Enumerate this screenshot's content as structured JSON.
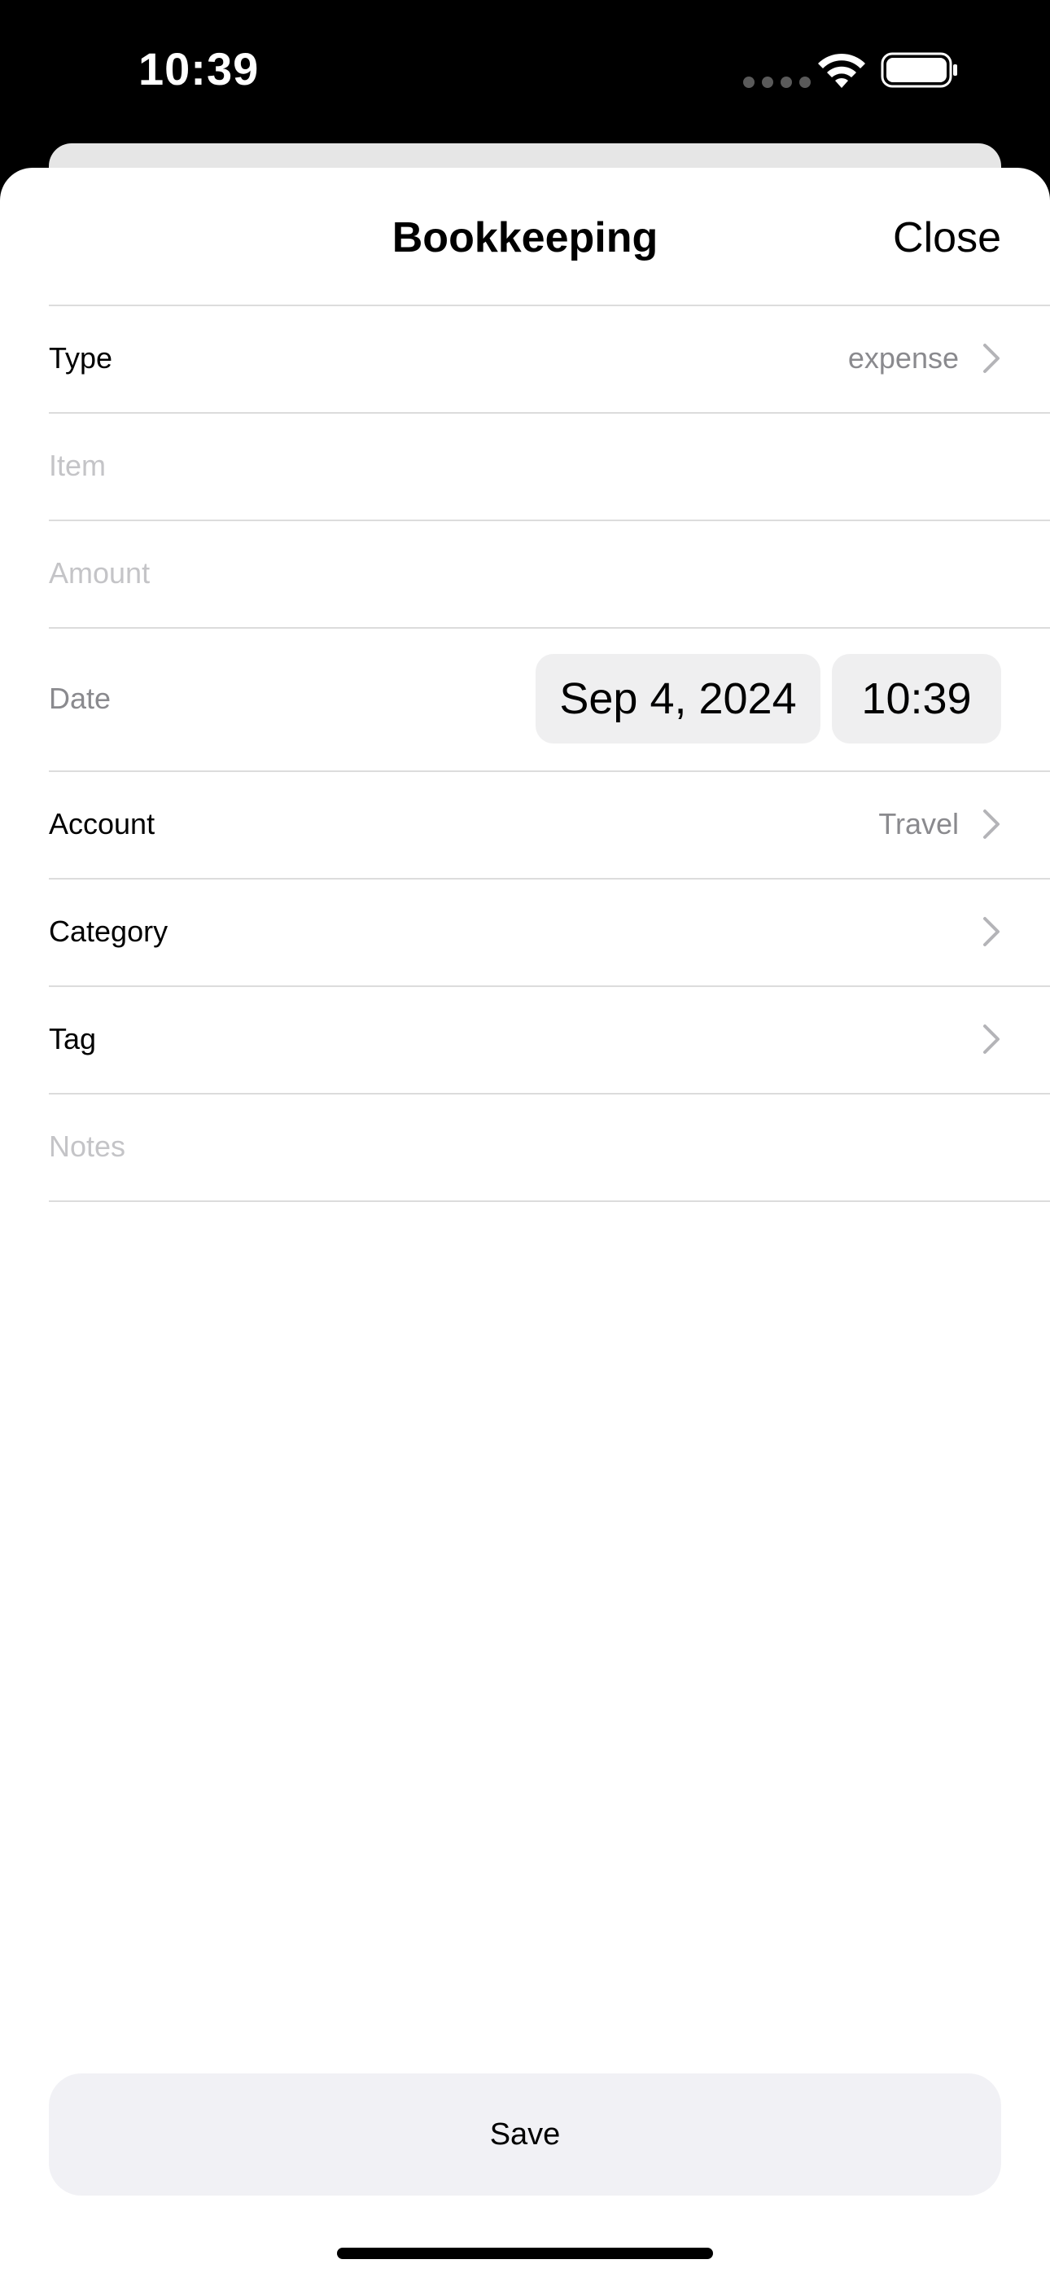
{
  "status_bar": {
    "time": "10:39",
    "icons": [
      "signal-dots-icon",
      "wifi-icon",
      "battery-icon"
    ]
  },
  "nav": {
    "title": "Bookkeeping",
    "close_label": "Close"
  },
  "form": {
    "type": {
      "label": "Type",
      "value": "expense"
    },
    "item": {
      "placeholder": "Item"
    },
    "amount": {
      "placeholder": "Amount"
    },
    "date": {
      "label": "Date",
      "date_value": "Sep 4, 2024",
      "time_value": "10:39"
    },
    "account": {
      "label": "Account",
      "value": "Travel"
    },
    "category": {
      "label": "Category"
    },
    "tag": {
      "label": "Tag"
    },
    "notes": {
      "placeholder": "Notes"
    }
  },
  "save_label": "Save",
  "colors": {
    "background": "#ffffff",
    "status_bar": "#000000",
    "secondary_text": "#8a8a8e",
    "placeholder_text": "#c4c4c7",
    "pill_background": "#efeff0",
    "save_background": "#f1f1f5"
  }
}
